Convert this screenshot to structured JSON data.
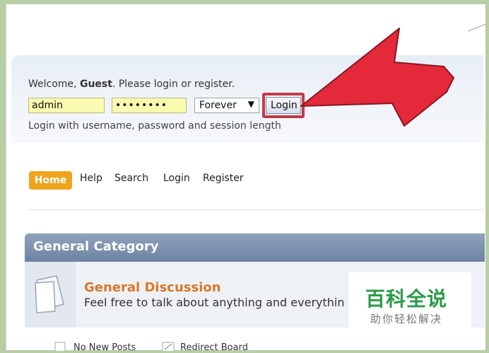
{
  "login": {
    "welcome_prefix": "Welcome, ",
    "welcome_user": "Guest",
    "welcome_suffix": ". Please login or register.",
    "username_value": "admin",
    "password_value": "••••••••",
    "session_value": "Forever",
    "login_button_label": "Login",
    "hint": "Login with username, password and session length"
  },
  "nav": {
    "items": [
      "Home",
      "Help",
      "Search",
      "Login",
      "Register"
    ]
  },
  "category": {
    "title": "General Category"
  },
  "board": {
    "title": "General Discussion",
    "description": "Feel free to talk about anything and everythin"
  },
  "legend": {
    "no_new_posts": "No New Posts",
    "redirect_board": "Redirect Board"
  },
  "watermark": {
    "main": "百科全说",
    "sub": "助你轻松解决"
  },
  "colors": {
    "annotation_arrow": "#e3293a",
    "home_tab": "#f0a31d",
    "category_bar": "#7a8fad",
    "board_title": "#d9772a",
    "watermark_text": "#2a9a47"
  }
}
